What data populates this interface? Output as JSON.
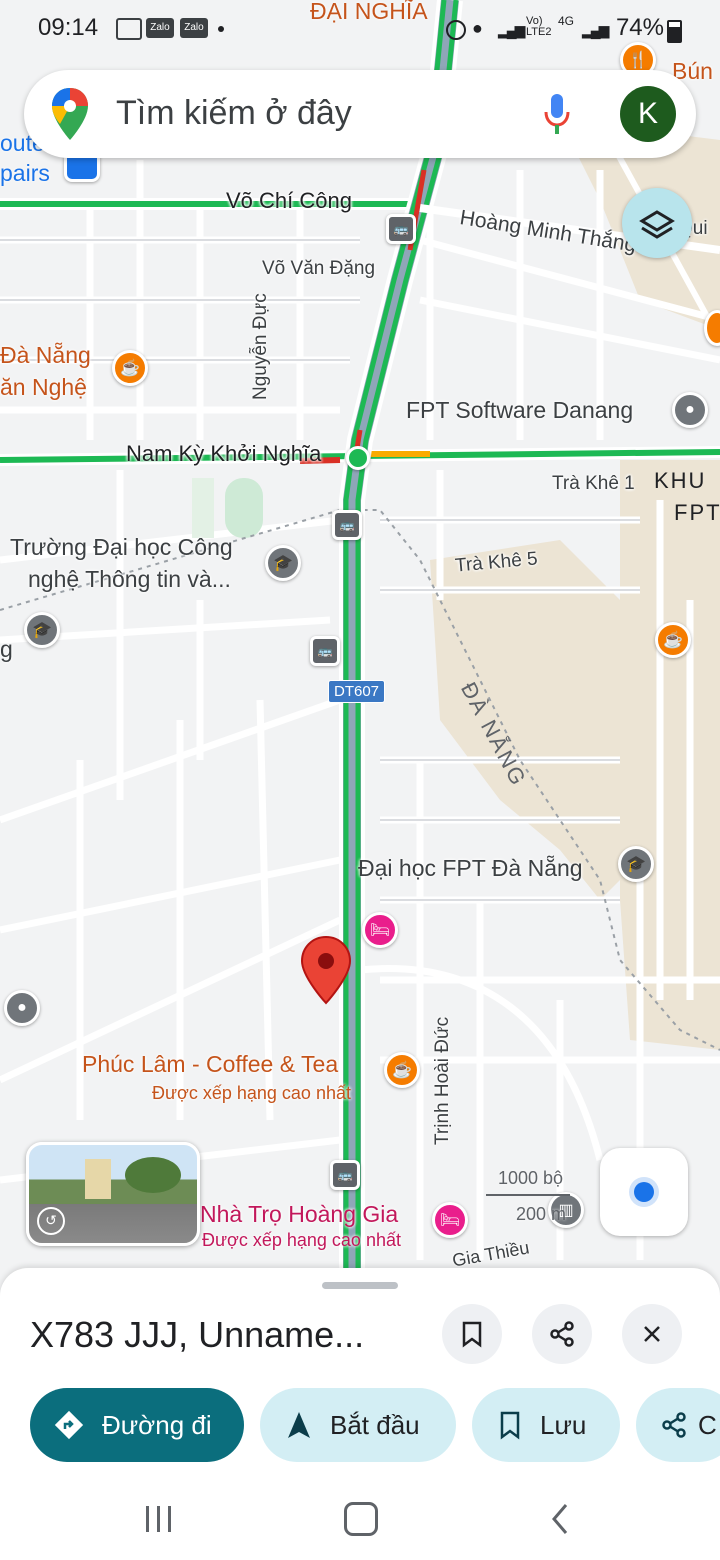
{
  "status_bar": {
    "time": "09:14",
    "notif_icons": [
      "image-icon",
      "Zalo",
      "Zalo"
    ],
    "network": "Vo) LTE2",
    "network_type": "4G",
    "battery": "74%"
  },
  "search": {
    "placeholder": "Tìm kiếm ở đây",
    "avatar_letter": "K"
  },
  "map": {
    "streets": {
      "vo_chi_cong": "Võ Chí Công",
      "hoang_minh_thang": "Hoàng Minh Thắng",
      "vo_van_dang": "Võ Văn Đặng",
      "nguyen_duc": "Nguyễn Đực",
      "nam_ky_khoi_nghia": "Nam Kỳ Khởi Nghĩa",
      "tra_khe_1": "Trà Khê 1",
      "tra_khe_5": "Trà Khê 5",
      "dt607": "DT607",
      "trinh_hoai_duc": "Trịnh Hoài Đức",
      "gia_thieu": "Gia Thiều",
      "qui": "Qui"
    },
    "areas": {
      "dai_nghia": "ĐẠI NGHĨA",
      "da_nang": "ĐÀ NẴNG",
      "khu": "KHU",
      "fpt": "FPT",
      "bun": "Bún",
      "route_stairs_1": "oute",
      "route_stairs_2": "pairs"
    },
    "pois": {
      "da_nang_van_nghe_1": "Đà Nẵng",
      "da_nang_van_nghe_2": "ăn Nghệ",
      "fpt_software": "FPT Software Danang",
      "truong_dh_1": "Trường Đại học Công",
      "truong_dh_2": "nghệ Thông tin và...",
      "dh_fpt": "Đại học FPT Đà Nẵng",
      "phuc_lam": "Phúc Lâm - Coffee & Tea",
      "phuc_lam_sub": "Được xếp hạng cao nhất",
      "nha_tro": "Nhà Trọ Hoàng Gia",
      "nha_tro_sub": "Được xếp hạng cao nhất",
      "g_left": "g"
    },
    "scale": {
      "feet": "1000 bộ",
      "meters": "200 m"
    },
    "colors": {
      "traffic_green": "#1db954",
      "traffic_red": "#d93025",
      "traffic_yellow": "#f9ab00",
      "pin_red": "#ea4335",
      "poi_orange": "#f57c00",
      "poi_gray": "#70757a",
      "poi_pink": "#e91e8c",
      "bus_stop": "#5f6368",
      "brand_teal": "#0b6e7d"
    }
  },
  "sheet": {
    "title": "X783 JJJ, Unname...",
    "actions": [
      {
        "label": "Đường đi",
        "icon": "directions-icon"
      },
      {
        "label": "Bắt đầu",
        "icon": "navigation-arrow-icon"
      },
      {
        "label": "Lưu",
        "icon": "bookmark-icon"
      },
      {
        "label": "C",
        "icon": "share-icon"
      }
    ]
  }
}
